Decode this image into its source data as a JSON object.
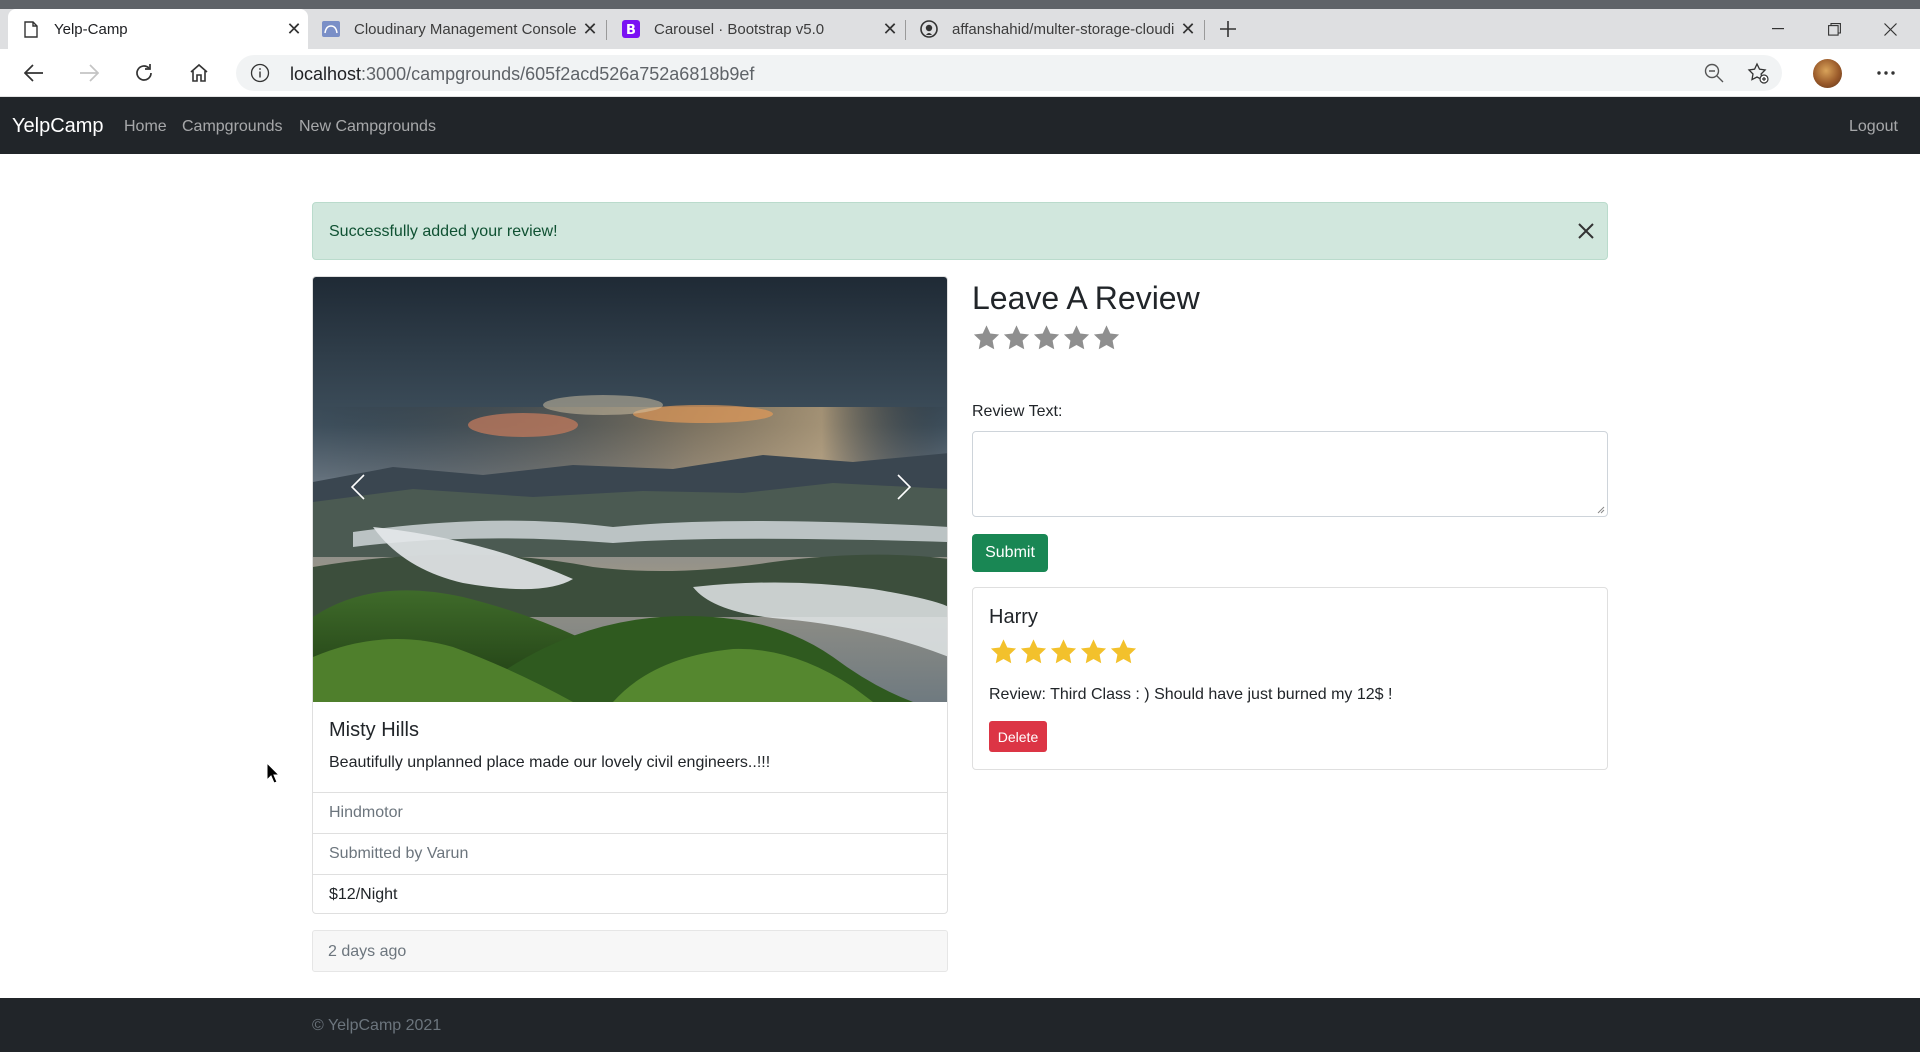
{
  "browser": {
    "tabs": [
      {
        "title": "Yelp-Camp",
        "icon": "page-icon",
        "active": true
      },
      {
        "title": "Cloudinary Management Console",
        "icon": "cloudinary-icon",
        "active": false
      },
      {
        "title": "Carousel · Bootstrap v5.0",
        "icon": "bootstrap-icon",
        "active": false
      },
      {
        "title": "affanshahid/multer-storage-cloudinary",
        "icon": "github-icon",
        "active": false
      }
    ],
    "url_host": "localhost",
    "url_path": ":3000/campgrounds/605f2acd526a752a6818b9ef"
  },
  "navbar": {
    "brand": "YelpCamp",
    "links": [
      "Home",
      "Campgrounds",
      "New Campgrounds"
    ],
    "logout": "Logout"
  },
  "alert": {
    "message": "Successfully added your review!"
  },
  "campground": {
    "title": "Misty Hills",
    "description": "Beautifully unplanned place made our lovely civil engineers..!!!",
    "location": "Hindmotor",
    "submitted_by": "Submitted by Varun",
    "price": "$12/Night",
    "posted": "2 days ago"
  },
  "review_form": {
    "heading": "Leave A Review",
    "rating": 0,
    "max_rating": 5,
    "label": "Review Text:",
    "text_value": "",
    "submit_label": "Submit"
  },
  "reviews": [
    {
      "author": "Harry",
      "rating": 5,
      "body": "Review: Third Class : ) Should have just burned my 12$ !",
      "delete_label": "Delete"
    }
  ],
  "footer": {
    "text": "© YelpCamp 2021"
  },
  "colors": {
    "navbar_bg": "#212529",
    "alert_bg": "#d1e7dd",
    "alert_text": "#0f5132",
    "submit_btn": "#198754",
    "delete_btn": "#dc3545",
    "star_filled": "#f3c12c",
    "star_empty": "#8f8f8f"
  }
}
